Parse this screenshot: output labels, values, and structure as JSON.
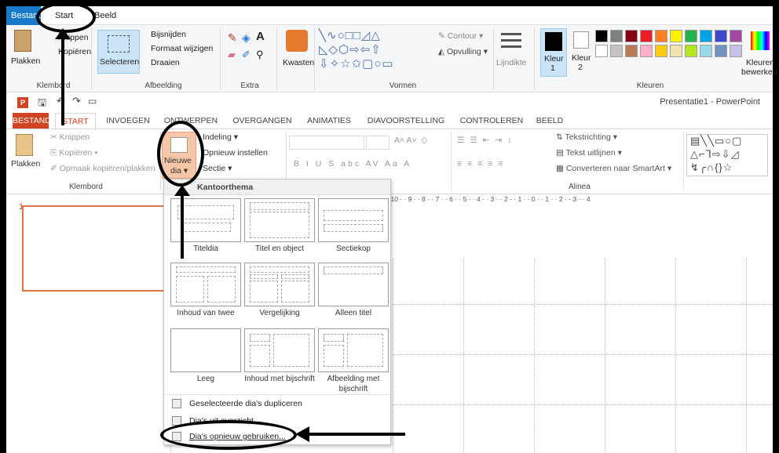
{
  "paint": {
    "tabs": [
      "Bestand",
      "Start",
      "Beeld"
    ],
    "clipboard": {
      "paste": "Plakken",
      "cut": "Knippen",
      "copy": "Kopiëren",
      "group": "Klembord"
    },
    "image": {
      "select": "Selecteren",
      "crop": "Bijsnijden",
      "resize": "Formaat wijzigen",
      "rotate": "Draaien",
      "group": "Afbeelding"
    },
    "tools": {
      "group": "Extra"
    },
    "brushes": {
      "label": "Kwasten"
    },
    "shapes": {
      "outline": "Contour",
      "fill": "Opvulling",
      "group": "Vormen"
    },
    "size": {
      "label": "Lijndikte"
    },
    "colors": {
      "color1": "Kleur",
      "color1_num": "1",
      "color2": "Kleur",
      "color2_num": "2",
      "edit": "Kleuren",
      "edit2": "bewerken",
      "group": "Kleuren",
      "palette_row1": [
        "#000000",
        "#7f7f7f",
        "#880015",
        "#ed1c24",
        "#ff7f27",
        "#fff200",
        "#22b14c",
        "#00a2e8",
        "#3f48cc",
        "#a349a4"
      ],
      "palette_row2": [
        "#ffffff",
        "#c3c3c3",
        "#b97a57",
        "#ffaec9",
        "#ffc90e",
        "#efe4b0",
        "#b5e61d",
        "#99d9ea",
        "#7092be",
        "#c8bfe7"
      ]
    }
  },
  "ppt": {
    "title": "Presentatie1 - PowerPoint",
    "tabs": [
      "BESTAND",
      "START",
      "INVOEGEN",
      "ONTWERPEN",
      "OVERGANGEN",
      "ANIMATIES",
      "DIAVOORSTELLING",
      "CONTROLEREN",
      "BEELD"
    ],
    "clipboard": {
      "paste": "Plakken",
      "cut": "Knippen",
      "copy": "Kopiëren",
      "format": "Opmaak kopiëren/plakken",
      "group": "Klembord"
    },
    "slides": {
      "new1": "Nieuwe",
      "new2": "dia",
      "layout": "Indeling",
      "reset": "Opnieuw instellen",
      "section": "Sectie"
    },
    "paragraph": {
      "direction": "Tekstrichting",
      "align": "Tekst uitlijnen",
      "smartart": "Converteren naar SmartArt",
      "group": "Alinea"
    },
    "slide_number": "1",
    "ruler": "1 · · 10 · · 9 · · 8 · · 7 · · 6 · · 5 · · 4 · · 3 · · 2 · · 1 · · 0 · · 1 · · 2 · · 3 · · 4"
  },
  "dropdown": {
    "header": "Kantoorthema",
    "layouts": [
      "Titeldia",
      "Titel en object",
      "Sectiekop",
      "Inhoud van twee",
      "Vergelijking",
      "Alleen titel",
      "Leeg",
      "Inhoud met bijschrift",
      "Afbeelding met bijschrift"
    ],
    "items": [
      "Geselecteerde dia's dupliceren",
      "Dia's uit overzicht",
      "Dia's opnieuw gebruiken..."
    ]
  }
}
